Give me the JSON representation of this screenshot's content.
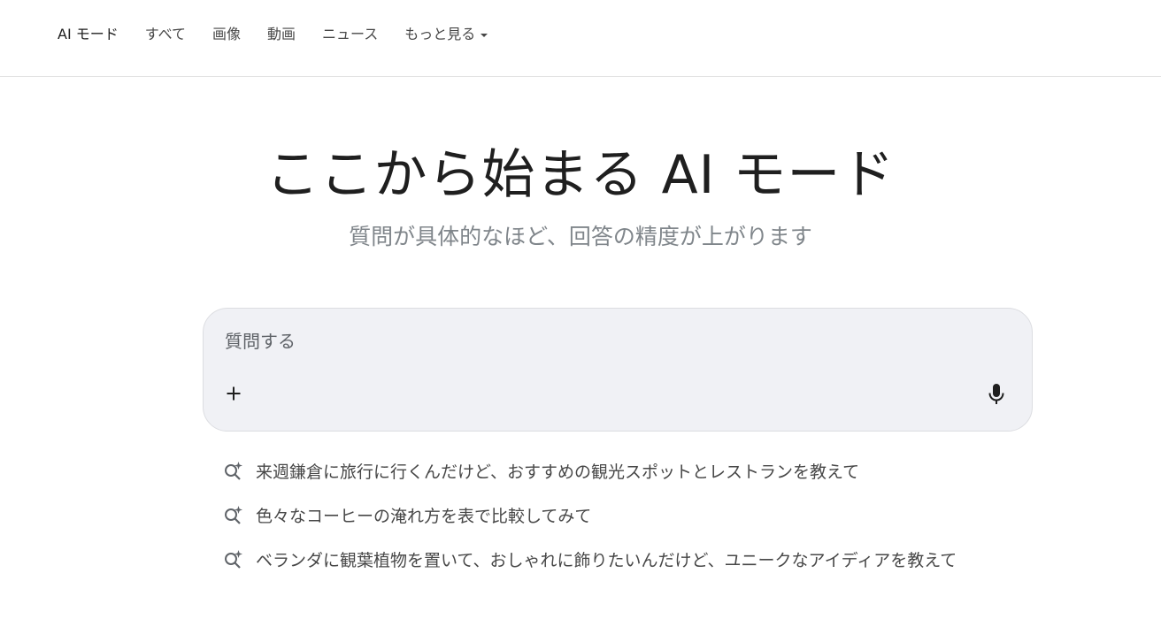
{
  "nav": {
    "tabs": [
      {
        "label": "AI モード",
        "active": true
      },
      {
        "label": "すべて"
      },
      {
        "label": "画像"
      },
      {
        "label": "動画"
      },
      {
        "label": "ニュース"
      },
      {
        "label": "もっと見る"
      }
    ]
  },
  "hero": {
    "title": "ここから始まる AI モード",
    "subtitle": "質問が具体的なほど、回答の精度が上がります"
  },
  "search": {
    "placeholder": "質問する",
    "value": "",
    "plus_icon": "plus-icon",
    "mic_icon": "microphone-icon"
  },
  "suggestions": [
    {
      "text": "来週鎌倉に旅行に行くんだけど、おすすめの観光スポットとレストランを教えて",
      "icon": "sparkle-search-icon"
    },
    {
      "text": "色々なコーヒーの淹れ方を表で比較してみて",
      "icon": "sparkle-search-icon"
    },
    {
      "text": "ベランダに観葉植物を置いて、おしゃれに飾りたいんだけど、ユニークなアイディアを教えて",
      "icon": "sparkle-search-icon"
    }
  ],
  "colors": {
    "search_bg": "#f0f1f5",
    "subtitle": "#80868b",
    "text": "#1f1f1f"
  }
}
